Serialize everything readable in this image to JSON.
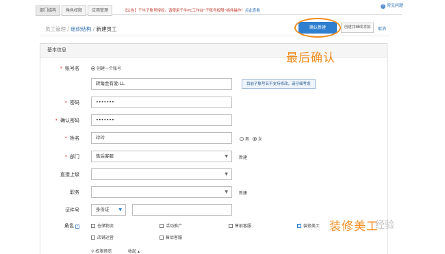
{
  "tabs": [
    "部门结构",
    "角色权限",
    "应用管理"
  ],
  "notice": {
    "text": "【公告】千牛子账号授权，请使用千牛PC工作台“子账号权限”插件操作！",
    "link": "点此查看"
  },
  "help": {
    "label": "常见问题",
    "icon": "question-icon"
  },
  "breadcrumb": {
    "part1": "员工管理",
    "sep1": " / ",
    "part2": "组织结构",
    "sep2": " / ",
    "part3": "新建员工"
  },
  "actions": {
    "confirm": "确认新建",
    "save_add": "创建并继续添加",
    "cancel": "取消"
  },
  "section_title": "基本信息",
  "annotations": {
    "confirm_hint": "最后确认",
    "role_hint": "装修美工"
  },
  "watermark": "经验",
  "colors": {
    "primary": "#2f7fd0",
    "annotation": "#f08c1e",
    "required": "#e53935"
  },
  "form": {
    "account": {
      "label": "账号名",
      "option": "创建一个账号",
      "value": "转角会有爱:LL",
      "tip": "目前子账号名不支持修改，请仔细考虑"
    },
    "password": {
      "label": "密码",
      "value": "•••••••"
    },
    "confirm_password": {
      "label": "确认密码",
      "value": "•••••••"
    },
    "name": {
      "label": "姓名",
      "value": "玲玲",
      "gender_male": "男",
      "gender_female": "女"
    },
    "department": {
      "label": "部门",
      "value": "售后客服",
      "new_link": "新建"
    },
    "superior": {
      "label": "直接上级",
      "value": ""
    },
    "position": {
      "label": "职务",
      "value": "",
      "new_link": "新建"
    },
    "id_doc": {
      "label": "证件号",
      "type": "身份证",
      "value": ""
    },
    "roles": {
      "label": "角色",
      "items": [
        {
          "label": "仓储物流",
          "checked": false
        },
        {
          "label": "活动推广",
          "checked": false
        },
        {
          "label": "售前客服",
          "checked": false
        },
        {
          "label": "装修美工",
          "checked": true
        },
        {
          "label": "店铺运营",
          "checked": false
        },
        {
          "label": "售后客服",
          "checked": false
        }
      ]
    },
    "permission_preview": {
      "label": "权限预览",
      "collapse": "收起"
    }
  }
}
